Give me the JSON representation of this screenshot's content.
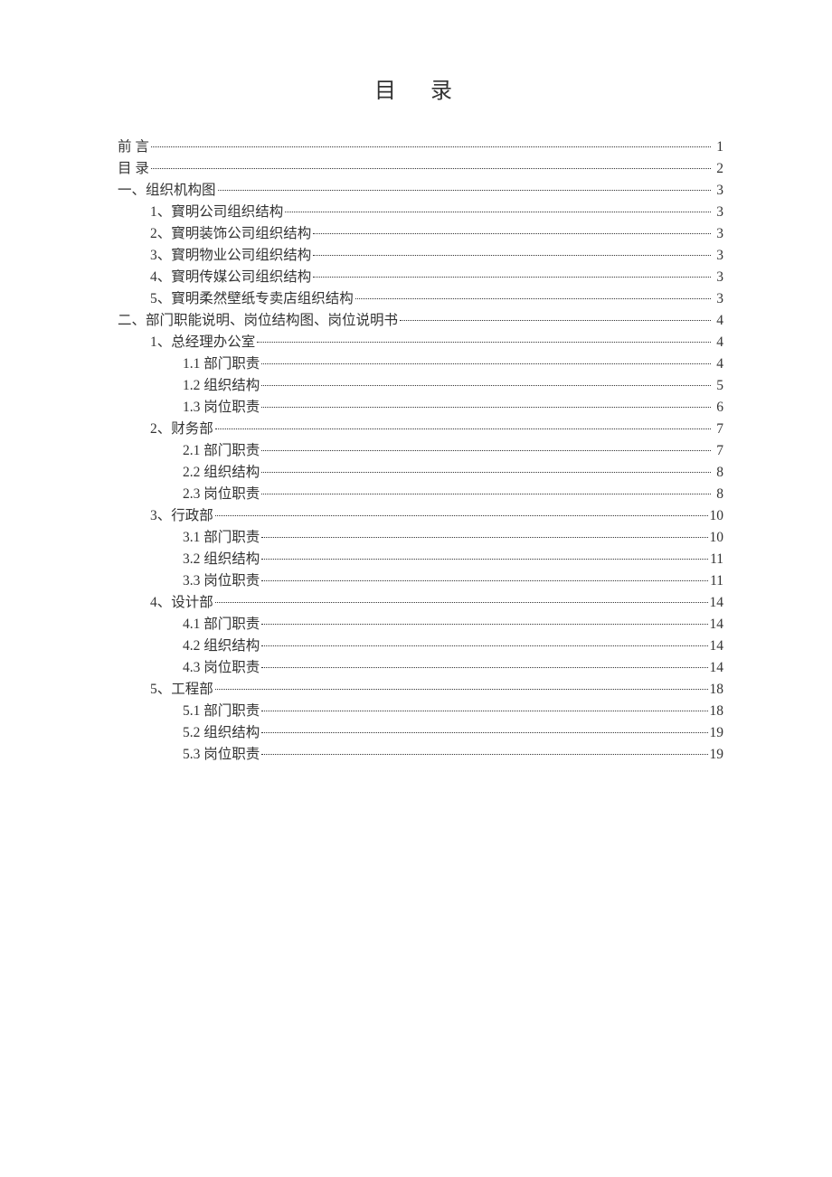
{
  "title": "目  录",
  "toc": [
    {
      "level": 0,
      "label": "前    言",
      "page": "1"
    },
    {
      "level": 0,
      "label": "目    录",
      "page": "2"
    },
    {
      "level": 0,
      "label": "一、组织机构图",
      "page": "3"
    },
    {
      "level": 1,
      "label": "1、寳明公司组织结构",
      "page": "3"
    },
    {
      "level": 1,
      "label": "2、寳明装饰公司组织结构",
      "page": "3"
    },
    {
      "level": 1,
      "label": "3、寳明物业公司组织结构",
      "page": "3"
    },
    {
      "level": 1,
      "label": "4、寳明传媒公司组织结构",
      "page": "3"
    },
    {
      "level": 1,
      "label": "5、寳明柔然壁纸专卖店组织结构",
      "page": "3"
    },
    {
      "level": 0,
      "label": "二、部门职能说明、岗位结构图、岗位说明书",
      "page": "4"
    },
    {
      "level": 1,
      "label": "1、总经理办公室",
      "page": "4"
    },
    {
      "level": 2,
      "label": "1.1 部门职责",
      "page": "4"
    },
    {
      "level": 2,
      "label": "1.2 组织结构",
      "page": "5"
    },
    {
      "level": 2,
      "label": "1.3 岗位职责",
      "page": "6"
    },
    {
      "level": 1,
      "label": "2、财务部",
      "page": "7"
    },
    {
      "level": 2,
      "label": "2.1 部门职责",
      "page": "7"
    },
    {
      "level": 2,
      "label": "2.2 组织结构",
      "page": "8"
    },
    {
      "level": 2,
      "label": "2.3 岗位职责",
      "page": "8"
    },
    {
      "level": 1,
      "label": "3、行政部",
      "page": "10"
    },
    {
      "level": 2,
      "label": "3.1 部门职责",
      "page": "10"
    },
    {
      "level": 2,
      "label": "3.2 组织结构",
      "page": "11"
    },
    {
      "level": 2,
      "label": "3.3 岗位职责",
      "page": "11"
    },
    {
      "level": 1,
      "label": "4、设计部",
      "page": "14"
    },
    {
      "level": 2,
      "label": "4.1 部门职责",
      "page": "14"
    },
    {
      "level": 2,
      "label": "4.2 组织结构",
      "page": "14"
    },
    {
      "level": 2,
      "label": "4.3 岗位职责",
      "page": "14"
    },
    {
      "level": 1,
      "label": "5、工程部",
      "page": "18"
    },
    {
      "level": 2,
      "label": "5.1 部门职责",
      "page": "18"
    },
    {
      "level": 2,
      "label": "5.2 组织结构",
      "page": "19"
    },
    {
      "level": 2,
      "label": "5.3 岗位职责",
      "page": "19"
    }
  ]
}
